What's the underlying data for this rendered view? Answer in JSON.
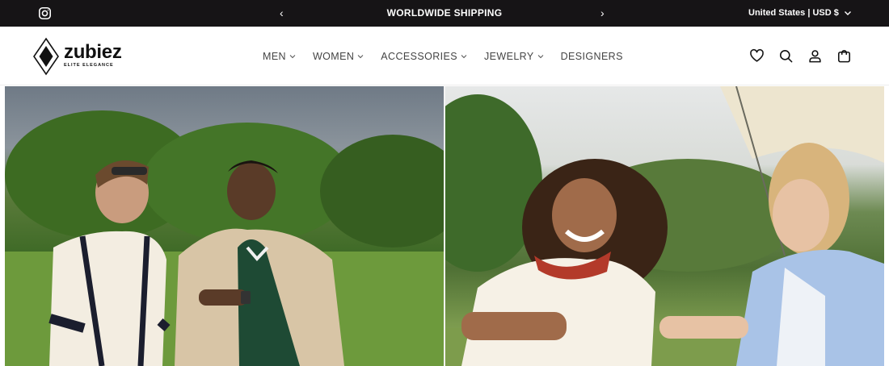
{
  "announcement": {
    "prev_label": "‹",
    "message": "WORLDWIDE SHIPPING",
    "next_label": "›",
    "locale": "United States | USD $",
    "social_icon": "instagram-icon"
  },
  "header": {
    "brand": "zubiez",
    "tagline": "ELITE ELEGANCE",
    "nav": [
      {
        "label": "MEN",
        "has_dropdown": true
      },
      {
        "label": "WOMEN",
        "has_dropdown": true
      },
      {
        "label": "ACCESSORIES",
        "has_dropdown": true
      },
      {
        "label": "JEWELRY",
        "has_dropdown": true
      },
      {
        "label": "DESIGNERS",
        "has_dropdown": false
      }
    ],
    "icons": [
      "heart-icon",
      "search-icon",
      "account-icon",
      "cart-icon"
    ]
  },
  "hero": {
    "left_image": "men-fashion-photo",
    "right_image": "women-fashion-photo"
  },
  "colors": {
    "topbar_bg": "#161416",
    "text": "#222222",
    "nav_text": "#444444"
  }
}
